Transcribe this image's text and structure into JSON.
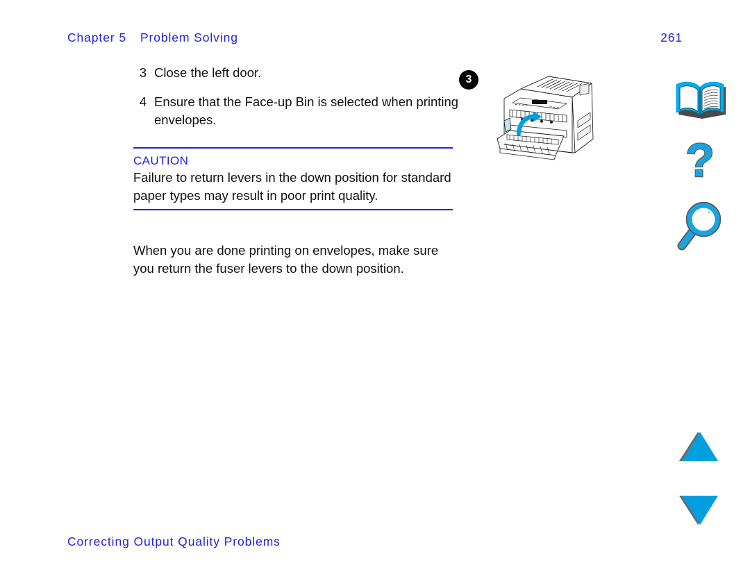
{
  "header": {
    "chapter_label": "Chapter 5",
    "chapter_title": "Problem Solving",
    "page_number": "261",
    "color": "#2222e0"
  },
  "steps": [
    {
      "number": "3",
      "text": "Close the left door."
    },
    {
      "number": "4",
      "text": "Ensure that the Face-up Bin is selected when printing envelopes."
    }
  ],
  "caution": {
    "title": "CAUTION",
    "body": "Failure to return levers in the down position for standard paper types may result in poor print quality.",
    "rule_color": "#2222e0"
  },
  "body_paragraph": "When you are done printing on envelopes, make sure you return the fuser levers to the down position.",
  "footer": {
    "section_title": "Correcting Output Quality Problems",
    "color": "#2222e0"
  },
  "figure": {
    "callout_number": "3",
    "caption": "printer-left-door-closing-illustration",
    "arrow_color": "#00a0e0"
  },
  "nav_icons": [
    {
      "name": "book-icon",
      "label": "Contents"
    },
    {
      "name": "question-mark-icon",
      "label": "Help"
    },
    {
      "name": "magnifier-icon",
      "label": "Search"
    },
    {
      "name": "triangle-up-icon",
      "label": "Previous Page"
    },
    {
      "name": "triangle-down-icon",
      "label": "Next Page"
    }
  ],
  "colors": {
    "accent_blue": "#2222e0",
    "icon_cyan": "#1ba3e0",
    "icon_shadow": "#6b6b6b",
    "text": "#111111"
  }
}
